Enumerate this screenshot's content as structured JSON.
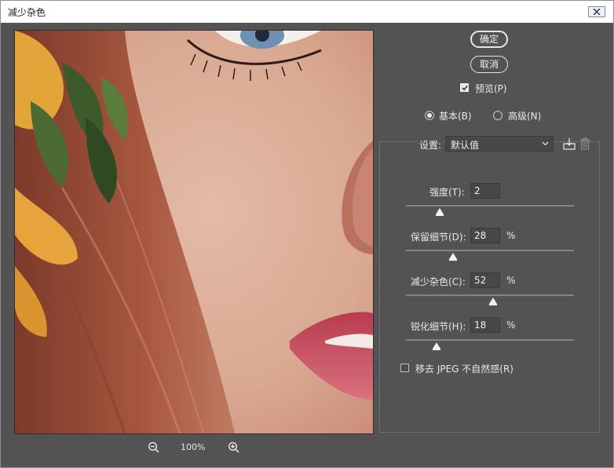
{
  "window": {
    "title": "减少杂色"
  },
  "buttons": {
    "ok": "确定",
    "cancel": "取消"
  },
  "preview_checkbox": {
    "label": "预览(P)",
    "checked": true
  },
  "mode": {
    "basic": "基本(B)",
    "advanced": "高级(N)",
    "selected": "basic"
  },
  "settings": {
    "label": "设置:",
    "value": "默认值"
  },
  "params": [
    {
      "label": "强度(T):",
      "value": "2",
      "unit": "",
      "fraction": 0.2
    },
    {
      "label": "保留细节(D):",
      "value": "28",
      "unit": "%",
      "fraction": 0.28
    },
    {
      "label": "减少杂色(C):",
      "value": "52",
      "unit": "%",
      "fraction": 0.52
    },
    {
      "label": "锐化细节(H):",
      "value": "18",
      "unit": "%",
      "fraction": 0.18
    }
  ],
  "jpeg_checkbox": {
    "label": "移去 JPEG 不自然感(R)",
    "checked": false
  },
  "zoom": {
    "level": "100%"
  }
}
